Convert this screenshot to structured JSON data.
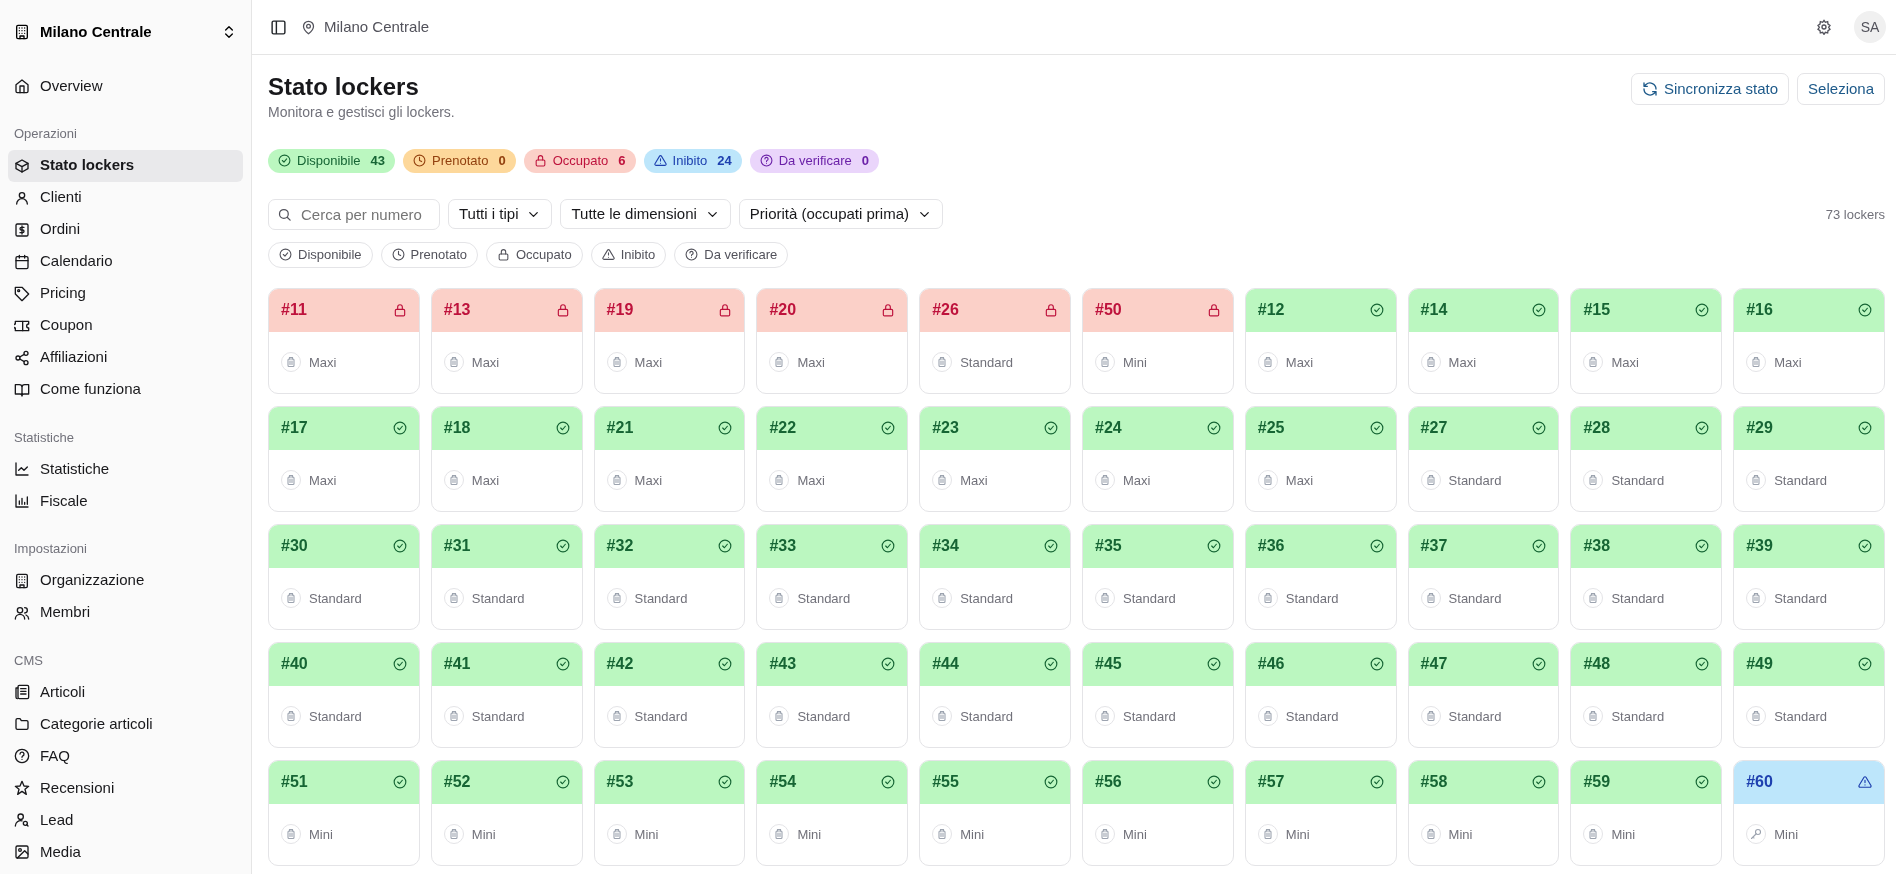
{
  "sidebar": {
    "location": "Milano Centrale",
    "sections": [
      {
        "items": [
          {
            "label": "Overview",
            "selected": false
          }
        ]
      },
      {
        "title": "Operazioni",
        "items": [
          {
            "label": "Stato lockers",
            "selected": true
          },
          {
            "label": "Clienti",
            "selected": false
          },
          {
            "label": "Ordini",
            "selected": false
          },
          {
            "label": "Calendario",
            "selected": false
          },
          {
            "label": "Pricing",
            "selected": false
          },
          {
            "label": "Coupon",
            "selected": false
          },
          {
            "label": "Affiliazioni",
            "selected": false
          },
          {
            "label": "Come funziona",
            "selected": false
          }
        ]
      },
      {
        "title": "Statistiche",
        "items": [
          {
            "label": "Statistiche",
            "selected": false
          },
          {
            "label": "Fiscale",
            "selected": false
          }
        ]
      },
      {
        "title": "Impostazioni",
        "items": [
          {
            "label": "Organizzazione",
            "selected": false
          },
          {
            "label": "Membri",
            "selected": false
          }
        ]
      },
      {
        "title": "CMS",
        "items": [
          {
            "label": "Articoli",
            "selected": false
          },
          {
            "label": "Categorie articoli",
            "selected": false
          },
          {
            "label": "FAQ",
            "selected": false
          },
          {
            "label": "Recensioni",
            "selected": false
          },
          {
            "label": "Lead",
            "selected": false
          },
          {
            "label": "Media",
            "selected": false
          }
        ]
      }
    ]
  },
  "topbar": {
    "breadcrumb": "Milano Centrale",
    "avatar": "SA"
  },
  "page": {
    "title": "Stato lockers",
    "subtitle": "Monitora e gestisci gli lockers.",
    "buttons": [
      {
        "label": "Sincronizza stato",
        "kind": "sync"
      },
      {
        "label": "Seleziona",
        "kind": "plain"
      }
    ]
  },
  "summary": [
    {
      "kind": "disponibile",
      "label": "Disponibile",
      "count": "43"
    },
    {
      "kind": "prenotato",
      "label": "Prenotato",
      "count": "0"
    },
    {
      "kind": "occupato",
      "label": "Occupato",
      "count": "6"
    },
    {
      "kind": "inibito",
      "label": "Inibito",
      "count": "24"
    },
    {
      "kind": "verificare",
      "label": "Da verificare",
      "count": "0"
    }
  ],
  "filters": {
    "search_placeholder": "Cerca per numero",
    "dropdowns": [
      "Tutti i tipi",
      "Tutte le dimensioni",
      "Priorità (occupati prima)"
    ],
    "total": "73 lockers"
  },
  "chips": [
    {
      "kind": "disponibile",
      "label": "Disponibile",
      "selected": false
    },
    {
      "kind": "prenotato",
      "label": "Prenotato",
      "selected": false
    },
    {
      "kind": "occupato",
      "label": "Occupato",
      "selected": false
    },
    {
      "kind": "inibito",
      "label": "Inibito",
      "selected": false
    },
    {
      "kind": "verificare",
      "label": "Da verificare",
      "selected": false
    }
  ],
  "lockers": [
    {
      "number": "#11",
      "size": "Maxi",
      "kind": "occupato"
    },
    {
      "number": "#13",
      "size": "Maxi",
      "kind": "occupato"
    },
    {
      "number": "#19",
      "size": "Maxi",
      "kind": "occupato"
    },
    {
      "number": "#20",
      "size": "Maxi",
      "kind": "occupato"
    },
    {
      "number": "#26",
      "size": "Standard",
      "kind": "occupato"
    },
    {
      "number": "#50",
      "size": "Mini",
      "kind": "occupato"
    },
    {
      "number": "#12",
      "size": "Maxi",
      "kind": "disponibile"
    },
    {
      "number": "#14",
      "size": "Maxi",
      "kind": "disponibile"
    },
    {
      "number": "#15",
      "size": "Maxi",
      "kind": "disponibile"
    },
    {
      "number": "#16",
      "size": "Maxi",
      "kind": "disponibile"
    },
    {
      "number": "#17",
      "size": "Maxi",
      "kind": "disponibile"
    },
    {
      "number": "#18",
      "size": "Maxi",
      "kind": "disponibile"
    },
    {
      "number": "#21",
      "size": "Maxi",
      "kind": "disponibile"
    },
    {
      "number": "#22",
      "size": "Maxi",
      "kind": "disponibile"
    },
    {
      "number": "#23",
      "size": "Maxi",
      "kind": "disponibile"
    },
    {
      "number": "#24",
      "size": "Maxi",
      "kind": "disponibile"
    },
    {
      "number": "#25",
      "size": "Maxi",
      "kind": "disponibile"
    },
    {
      "number": "#27",
      "size": "Standard",
      "kind": "disponibile"
    },
    {
      "number": "#28",
      "size": "Standard",
      "kind": "disponibile"
    },
    {
      "number": "#29",
      "size": "Standard",
      "kind": "disponibile"
    },
    {
      "number": "#30",
      "size": "Standard",
      "kind": "disponibile"
    },
    {
      "number": "#31",
      "size": "Standard",
      "kind": "disponibile"
    },
    {
      "number": "#32",
      "size": "Standard",
      "kind": "disponibile"
    },
    {
      "number": "#33",
      "size": "Standard",
      "kind": "disponibile"
    },
    {
      "number": "#34",
      "size": "Standard",
      "kind": "disponibile"
    },
    {
      "number": "#35",
      "size": "Standard",
      "kind": "disponibile"
    },
    {
      "number": "#36",
      "size": "Standard",
      "kind": "disponibile"
    },
    {
      "number": "#37",
      "size": "Standard",
      "kind": "disponibile"
    },
    {
      "number": "#38",
      "size": "Standard",
      "kind": "disponibile"
    },
    {
      "number": "#39",
      "size": "Standard",
      "kind": "disponibile"
    },
    {
      "number": "#40",
      "size": "Standard",
      "kind": "disponibile"
    },
    {
      "number": "#41",
      "size": "Standard",
      "kind": "disponibile"
    },
    {
      "number": "#42",
      "size": "Standard",
      "kind": "disponibile"
    },
    {
      "number": "#43",
      "size": "Standard",
      "kind": "disponibile"
    },
    {
      "number": "#44",
      "size": "Standard",
      "kind": "disponibile"
    },
    {
      "number": "#45",
      "size": "Standard",
      "kind": "disponibile"
    },
    {
      "number": "#46",
      "size": "Standard",
      "kind": "disponibile"
    },
    {
      "number": "#47",
      "size": "Standard",
      "kind": "disponibile"
    },
    {
      "number": "#48",
      "size": "Standard",
      "kind": "disponibile"
    },
    {
      "number": "#49",
      "size": "Standard",
      "kind": "disponibile"
    },
    {
      "number": "#51",
      "size": "Mini",
      "kind": "disponibile"
    },
    {
      "number": "#52",
      "size": "Mini",
      "kind": "disponibile"
    },
    {
      "number": "#53",
      "size": "Mini",
      "kind": "disponibile"
    },
    {
      "number": "#54",
      "size": "Mini",
      "kind": "disponibile"
    },
    {
      "number": "#55",
      "size": "Mini",
      "kind": "disponibile"
    },
    {
      "number": "#56",
      "size": "Mini",
      "kind": "disponibile"
    },
    {
      "number": "#57",
      "size": "Mini",
      "kind": "disponibile"
    },
    {
      "number": "#58",
      "size": "Mini",
      "kind": "disponibile"
    },
    {
      "number": "#59",
      "size": "Mini",
      "kind": "disponibile"
    },
    {
      "number": "#60",
      "size": "Mini",
      "kind": "inibito"
    }
  ]
}
